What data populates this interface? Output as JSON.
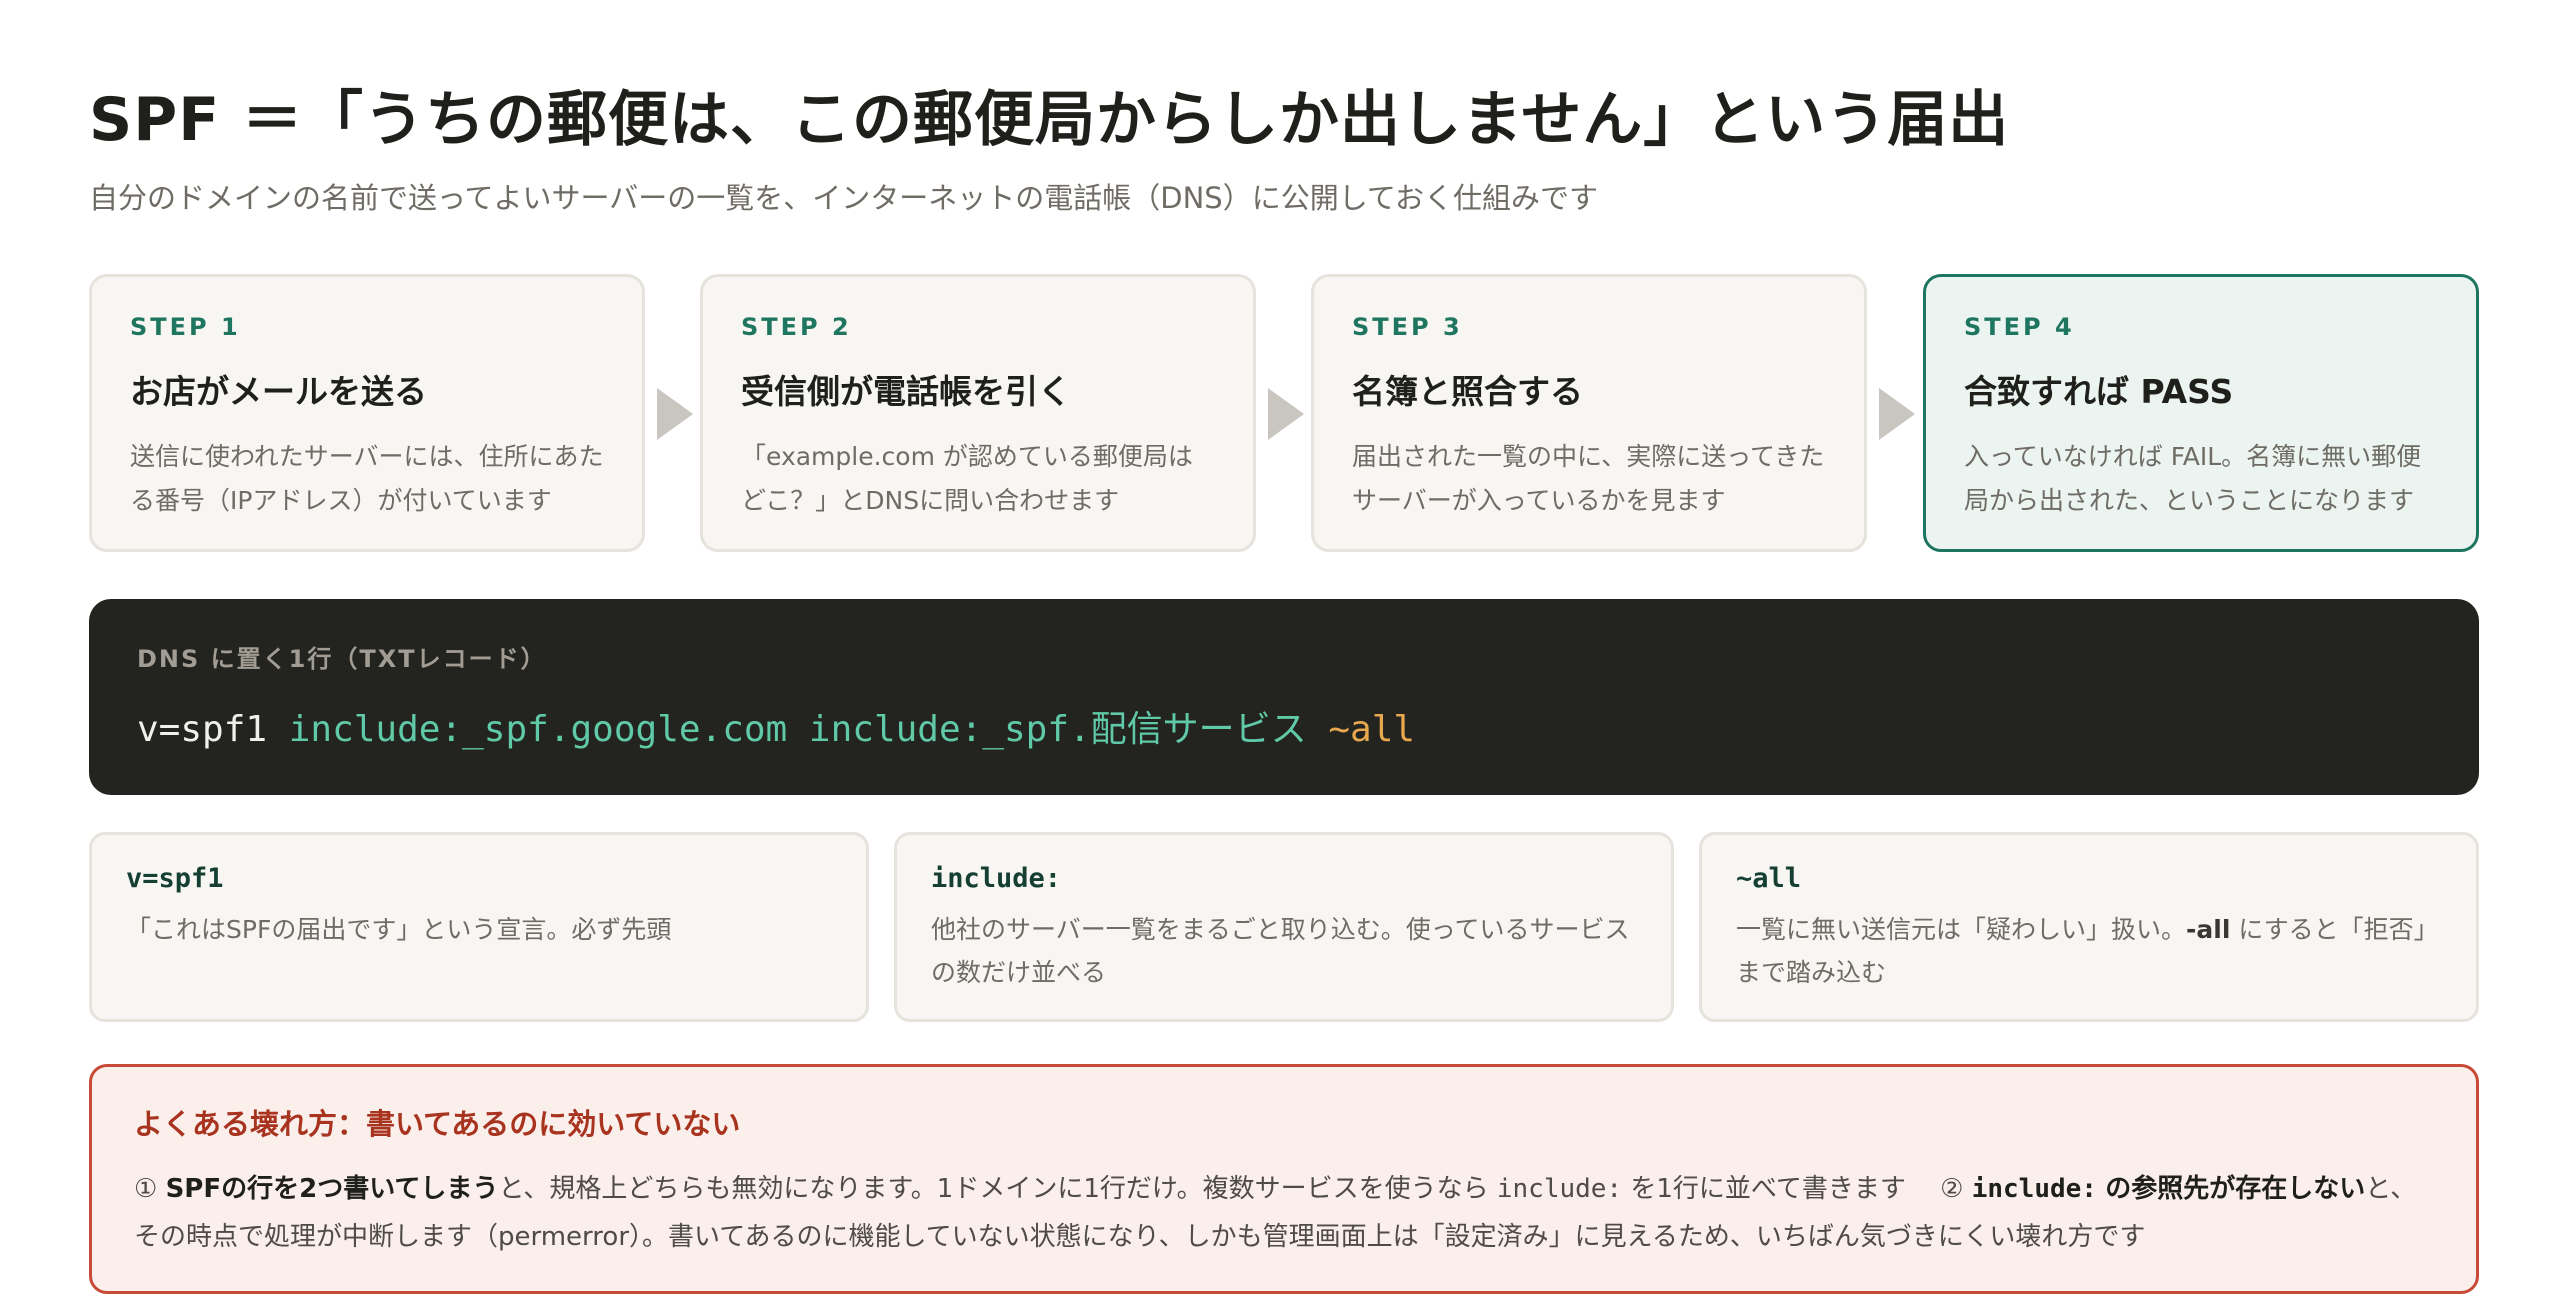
{
  "header": {
    "title": "SPF ＝「うちの郵便は、この郵便局からしか出しません」という届出",
    "subtitle": "自分のドメインの名前で送ってよいサーバーの一覧を、インターネットの電話帳（DNS）に公開しておく仕組みです"
  },
  "steps": [
    {
      "label": "STEP 1",
      "title": "お店がメールを送る",
      "desc": "送信に使われたサーバーには、住所にあたる番号（IPアドレス）が付いています"
    },
    {
      "label": "STEP 2",
      "title": "受信側が電話帳を引く",
      "desc": "「example.com が認めている郵便局はどこ？」とDNSに問い合わせます"
    },
    {
      "label": "STEP 3",
      "title": "名簿と照合する",
      "desc": "届出された一覧の中に、実際に送ってきたサーバーが入っているかを見ます"
    },
    {
      "label": "STEP 4",
      "title": "合致すれば PASS",
      "desc": "入っていなければ FAIL。名簿に無い郵便局から出された、ということになります"
    }
  ],
  "dns": {
    "label": "DNS に置く1行（TXTレコード）",
    "version": "v=spf1",
    "include1": "include:_spf.google.com",
    "include2": "include:_spf.配信サービス",
    "all": "~all"
  },
  "params": [
    {
      "key": "v=spf1",
      "desc": "「これはSPFの届出です」という宣言。必ず先頭"
    },
    {
      "key": "include:",
      "desc": "他社のサーバー一覧をまるごと取り込む。使っているサービスの数だけ並べる"
    },
    {
      "key": "~all",
      "desc_pre": "一覧に無い送信元は「疑わしい」扱い。",
      "desc_bold": "-all",
      "desc_post": " にすると「拒否」まで踏み込む"
    }
  ],
  "warning": {
    "title": "よくある壊れ方：書いてあるのに効いていない",
    "p1_num": "①",
    "p1_bold": "SPFの行を2つ書いてしまう",
    "p1_text": "と、規格上どちらも無効になります。1ドメインに1行だけ。複数サービスを使うなら",
    "p1_code": "include:",
    "p1_tail": "を1行に並べて書きます",
    "p2_num": "②",
    "p2_code": "include:",
    "p2_bold": "の参照先が存在しない",
    "p2_text": "と、その時点で処理が中断します（permerror）。書いてあるのに機能していない状態になり、しかも管理画面上は「設定済み」に見えるため、いちばん気づきにくい壊れ方です"
  },
  "colors": {
    "accent": "#1f7660",
    "code_bg": "#232320",
    "include": "#5fc9a8",
    "all": "#e8a94e",
    "warn": "#c64a35"
  }
}
